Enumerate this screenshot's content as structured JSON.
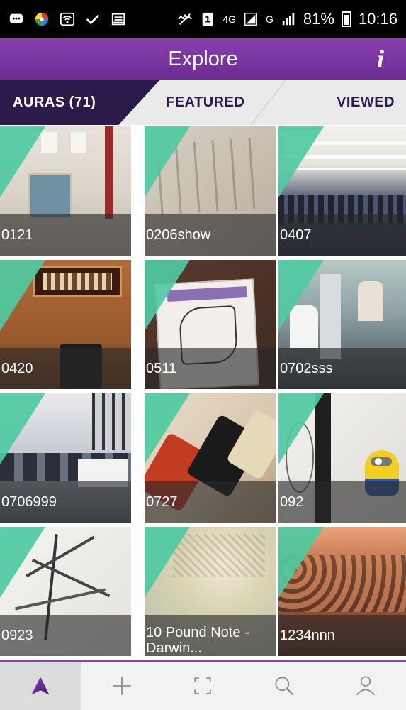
{
  "status_bar": {
    "network_4g": "4G",
    "network_g": "G",
    "battery": "81%",
    "time": "10:16"
  },
  "header": {
    "title": "Explore",
    "info_label": "i"
  },
  "tabs": [
    {
      "label": "AURAS (71)",
      "active": true
    },
    {
      "label": "FEATURED",
      "active": false
    },
    {
      "label": "VIEWED",
      "active": false
    }
  ],
  "grid": {
    "items": [
      {
        "label": "0121",
        "theme": "hallway"
      },
      {
        "label": "0206show",
        "theme": "paper"
      },
      {
        "label": "0407",
        "theme": "auditorium"
      },
      {
        "label": "0420",
        "theme": "room"
      },
      {
        "label": "0511",
        "theme": "sketch"
      },
      {
        "label": "0702sss",
        "theme": "lab"
      },
      {
        "label": "0706999",
        "theme": "office"
      },
      {
        "label": "0727",
        "theme": "phones"
      },
      {
        "label": "092",
        "theme": "sketch-minion"
      },
      {
        "label": "0923",
        "theme": "tree-sketch"
      },
      {
        "label": "10 Pound Note - Darwin...",
        "theme": "banknote"
      },
      {
        "label": "1234nnn",
        "theme": "crowd"
      }
    ]
  },
  "bottom_nav": [
    {
      "icon": "aura-logo-icon",
      "active": true
    },
    {
      "icon": "plus-icon",
      "active": false
    },
    {
      "icon": "scan-frame-icon",
      "active": false
    },
    {
      "icon": "search-icon",
      "active": false
    },
    {
      "icon": "profile-icon",
      "active": false
    }
  ],
  "colors": {
    "header_purple": "#7a35a3",
    "tab_active_bg": "#2b1a4a",
    "accent_teal": "#4fcaa2",
    "nav_active": "#6a2c93"
  }
}
